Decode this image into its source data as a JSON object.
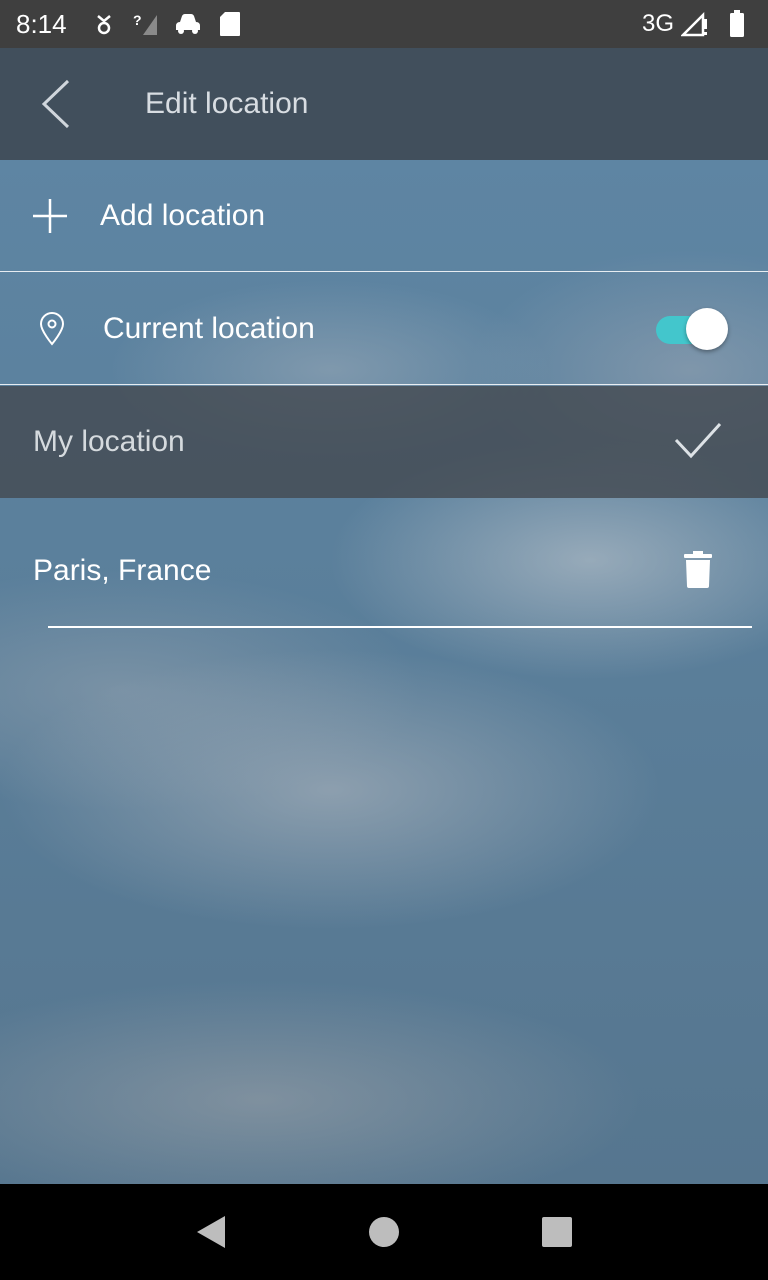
{
  "status_bar": {
    "time": "8:14",
    "network": "3G",
    "icons": [
      "data-saver-icon",
      "signal-unknown-icon",
      "car-icon",
      "sd-card-icon",
      "cell-signal-icon",
      "battery-icon"
    ]
  },
  "app_bar": {
    "title": "Edit location",
    "back_icon": "chevron-left-icon"
  },
  "add_location": {
    "label": "Add location",
    "icon": "plus-icon"
  },
  "current_location": {
    "label": "Current location",
    "icon": "map-pin-icon",
    "toggle_on": true
  },
  "my_location": {
    "label": "My location",
    "icon": "checkmark-icon"
  },
  "locations": [
    {
      "name": "Paris, France",
      "icon": "trash-icon"
    }
  ],
  "colors": {
    "toggle_track": "#43c6cc",
    "app_bar": "#3e4852",
    "status_bar": "#3f3f3f",
    "nav_bar": "#000000"
  },
  "nav_bar": {
    "icons": [
      "back-triangle-icon",
      "home-circle-icon",
      "recents-square-icon"
    ]
  }
}
